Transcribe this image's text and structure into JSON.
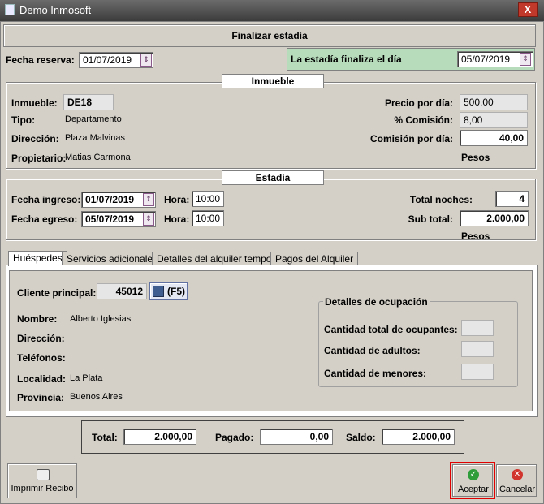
{
  "window": {
    "title": "Demo Inmosoft",
    "close": "X"
  },
  "header": {
    "title": "Finalizar estadía"
  },
  "reserva": {
    "label": "Fecha reserva:",
    "value": "01/07/2019"
  },
  "finaliza": {
    "label": "La estadía finaliza el día",
    "value": "05/07/2019"
  },
  "inmueble": {
    "section_title": "Inmueble",
    "inmueble_label": "Inmueble:",
    "inmueble_value": "DE18",
    "tipo_label": "Tipo:",
    "tipo_value": "Departamento",
    "direccion_label": "Dirección:",
    "direccion_value": "Plaza Malvinas",
    "propietario_label": "Propietario:",
    "propietario_value": "Matias Carmona",
    "precio_label": "Precio por día:",
    "precio_value": "500,00",
    "comision_pct_label": "% Comisión:",
    "comision_pct_value": "8,00",
    "comision_dia_label": "Comisión por día:",
    "comision_dia_value": "40,00",
    "pesos": "Pesos"
  },
  "estadia": {
    "section_title": "Estadía",
    "ingreso_label": "Fecha ingreso:",
    "ingreso_value": "01/07/2019",
    "egreso_label": "Fecha egreso:",
    "egreso_value": "05/07/2019",
    "hora_label": "Hora:",
    "hora_ingreso": "10:00",
    "hora_egreso": "10:00",
    "noches_label": "Total noches:",
    "noches_value": "4",
    "subtotal_label": "Sub total:",
    "subtotal_value": "2.000,00",
    "pesos": "Pesos"
  },
  "tabs": [
    {
      "label": "Huéspedes"
    },
    {
      "label": "Servicios adicionales"
    },
    {
      "label": "Detalles del alquiler temporal"
    },
    {
      "label": "Pagos del Alquiler"
    }
  ],
  "huespedes": {
    "cliente_label": "Cliente principal:",
    "cliente_value": "45012",
    "f5_label": "(F5)",
    "nombre_label": "Nombre:",
    "nombre_value": "Alberto Iglesias",
    "direccion_label": "Dirección:",
    "direccion_value": "",
    "telefonos_label": "Teléfonos:",
    "telefonos_value": "",
    "localidad_label": "Localidad:",
    "localidad_value": "La Plata",
    "provincia_label": "Provincia:",
    "provincia_value": "Buenos Aires",
    "ocupacion_title": "Detalles de ocupación",
    "total_ocupantes_label": "Cantidad total de ocupantes:",
    "adultos_label": "Cantidad de adultos:",
    "menores_label": "Cantidad de menores:"
  },
  "totales": {
    "total_label": "Total:",
    "total_value": "2.000,00",
    "pagado_label": "Pagado:",
    "pagado_value": "0,00",
    "saldo_label": "Saldo:",
    "saldo_value": "2.000,00"
  },
  "footer": {
    "imprimir_label": "Imprimir Recibo",
    "aceptar_label": "Aceptar",
    "cancelar_label": "Cancelar"
  },
  "colors": {
    "finaliza_bg": "#b7dcbc",
    "highlight_border": "#e00000",
    "accept_green": "#2f9e3a",
    "cancel_red": "#d0342c"
  }
}
